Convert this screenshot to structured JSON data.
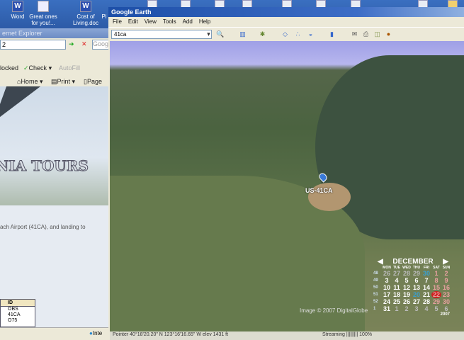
{
  "desktop": {
    "icons": [
      {
        "label": "Word"
      },
      {
        "label": "Great ones for you!..."
      },
      {
        "label": "Cost of Living.doc"
      },
      {
        "label": "Pi"
      }
    ]
  },
  "ie": {
    "title": "ernet Explorer",
    "address": "2",
    "search_placeholder": "Goog",
    "toolbar": {
      "blocked": "locked",
      "check": "Check",
      "autofill": "AutoFill",
      "home": "Home",
      "print": "Print",
      "page": "Page"
    },
    "banner_text": "NIA TOURS",
    "body_text": "ach Airport (41CA), and landing to",
    "table": {
      "header": "ID",
      "rows": [
        "OBS",
        "41CA",
        "O75"
      ]
    },
    "status": "Inte"
  },
  "ge": {
    "title": "Google Earth",
    "menu": [
      "File",
      "Edit",
      "View",
      "Tools",
      "Add",
      "Help"
    ],
    "search_value": "41ca",
    "placemark": "US-41CA",
    "copyright": "Image © 2007 DigitalGlobe",
    "status": {
      "pointer": "Pointer  40°18'20.20\" N    123°16'16.65\" W   elev  1431 ft",
      "streaming": "Streaming ||||||||| 100%"
    },
    "calendar": {
      "month": "DECEMBER",
      "year": "2007",
      "days": [
        "MON",
        "TUE",
        "WED",
        "THU",
        "FRI",
        "SAT",
        "SUN"
      ],
      "weeks": [
        {
          "n": "48",
          "d": [
            "26",
            "27",
            "28",
            "29",
            "30",
            "1",
            "2"
          ]
        },
        {
          "n": "49",
          "d": [
            "3",
            "4",
            "5",
            "6",
            "7",
            "8",
            "9"
          ]
        },
        {
          "n": "50",
          "d": [
            "10",
            "11",
            "12",
            "13",
            "14",
            "15",
            "16"
          ]
        },
        {
          "n": "51",
          "d": [
            "17",
            "18",
            "19",
            "20",
            "21",
            "22",
            "23"
          ]
        },
        {
          "n": "52",
          "d": [
            "24",
            "25",
            "26",
            "27",
            "28",
            "29",
            "30"
          ]
        },
        {
          "n": "1",
          "d": [
            "31",
            "1",
            "2",
            "3",
            "4",
            "5",
            "6"
          ]
        }
      ],
      "selected": "22"
    }
  },
  "colors": {
    "titlebar": "#1d4fa8",
    "today": "#d02020"
  }
}
